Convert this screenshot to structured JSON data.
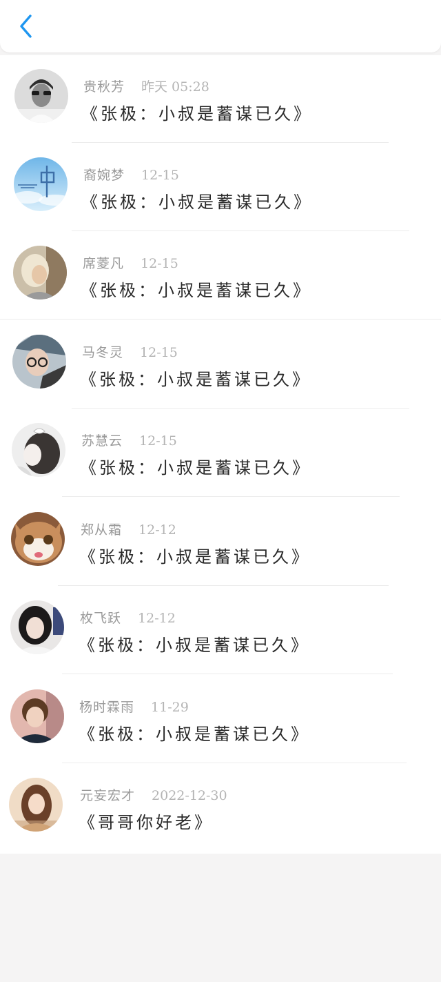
{
  "header": {
    "back_icon": "chevron-left-icon",
    "accent": "#1e96f0"
  },
  "conversations": [
    {
      "name": "贵秋芳",
      "time": "昨天 05:28",
      "message": "《张极：小叔是蓄谋已久》",
      "avatar": "avatar-man-sunglasses"
    },
    {
      "name": "裔婉梦",
      "time": "12-15",
      "message": "《张极：小叔是蓄谋已久》",
      "avatar": "avatar-sky-text"
    },
    {
      "name": "席菱凡",
      "time": "12-15",
      "message": "《张极：小叔是蓄谋已久》",
      "avatar": "avatar-blond-person"
    },
    {
      "name": "马冬灵",
      "time": "12-15",
      "message": "《张极：小叔是蓄谋已久》",
      "avatar": "avatar-boy-glasses"
    },
    {
      "name": "苏慧云",
      "time": "12-15",
      "message": "《张极：小叔是蓄谋已久》",
      "avatar": "avatar-girl-bow"
    },
    {
      "name": "郑从霜",
      "time": "12-12",
      "message": "《张极：小叔是蓄谋已久》",
      "avatar": "avatar-cat"
    },
    {
      "name": "枚飞跃",
      "time": "12-12",
      "message": "《张极：小叔是蓄谋已久》",
      "avatar": "avatar-girl-dark-hair"
    },
    {
      "name": "杨时霖雨",
      "time": "11-29",
      "message": "《张极：小叔是蓄谋已久》",
      "avatar": "avatar-boy-brown-hair"
    },
    {
      "name": "元妄宏才",
      "time": "2022-12-30",
      "message": "《哥哥你好老》",
      "avatar": "avatar-girl-long-hair"
    }
  ]
}
